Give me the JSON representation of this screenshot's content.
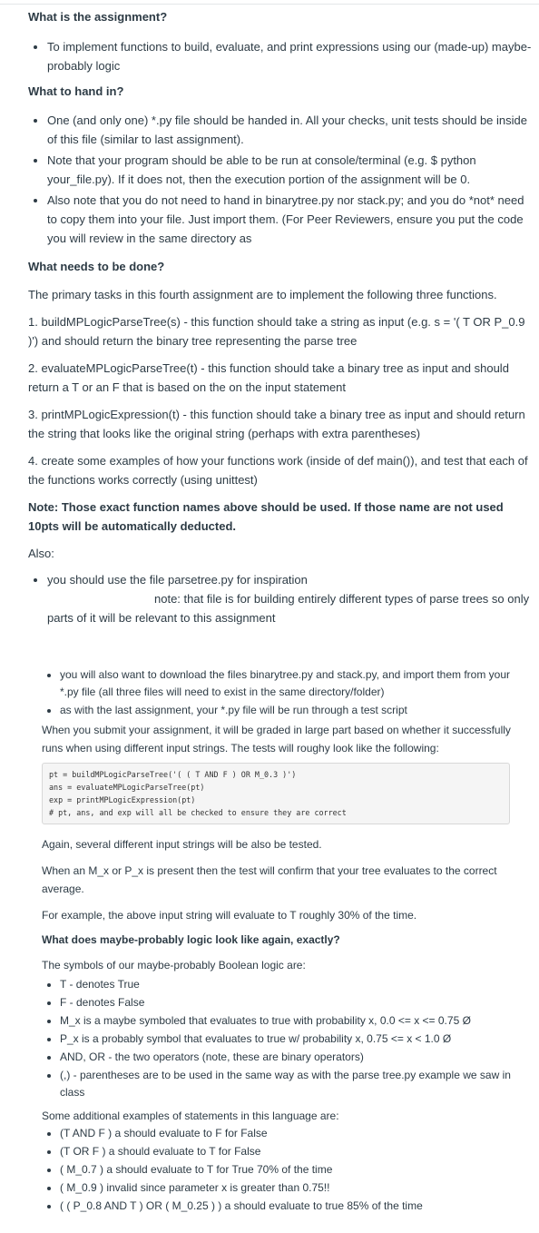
{
  "assignment": {
    "heading": "What is the assignment?",
    "bullets": [
      "To implement functions to build, evaluate, and print expressions using our (made-up) maybe-probably logic"
    ]
  },
  "handin": {
    "heading": "What to hand in?",
    "bullets": [
      "One (and only one) *.py file should be handed in. All your checks, unit tests should be inside of this file (similar to last assignment).",
      "Note that your program should be able to be run at console/terminal (e.g. $ python your_file.py). If it does not, then the execution portion of the assignment will be 0.",
      "Also note that you do not need to hand in binarytree.py nor stack.py; and you do *not* need to copy them into your file. Just import them. (For Peer Reviewers, ensure you put the code you will review in the same directory as"
    ]
  },
  "todo": {
    "heading": "What needs to be done?",
    "intro": "The primary tasks in this fourth assignment are to implement the following three functions.",
    "items": [
      "1. buildMPLogicParseTree(s) - this function should take a string as input (e.g. s = '( T OR P_0.9 )') and should return the binary tree representing the parse tree",
      "2. evaluateMPLogicParseTree(t) - this function should take a binary tree as input and should return a T or an F that is based on the on the input statement",
      "3. printMPLogicExpression(t) - this function should take a binary tree as input and should return the string that looks like the original string (perhaps with extra parentheses)",
      "4. create some examples of how your functions work (inside of def main()), and test that each of the functions works correctly (using unittest)"
    ],
    "note": "Note: Those exact function names above should be used. If those name are not used 10pts will be automatically deducted.",
    "also": "Also:",
    "also_bullet": "you should use the file parsetree.py for inspiration",
    "also_note": "note: that file is for building entirely different types of parse trees so only",
    "also_note_cont": "parts of it will be relevant to this assignment"
  },
  "sub": {
    "bullets": [
      "you will also want to download the files binarytree.py and stack.py, and import them from your *.py file (all three files will need to exist in the same directory/folder)",
      "as with the last assignment, your *.py file will be run through a test script"
    ],
    "submit_text": "When you submit your assignment, it will be graded in large part based on whether it successfully runs when using different input strings. The tests will roughy look like the following:",
    "code": "pt = buildMPLogicParseTree('( ( T AND F ) OR M_0.3 )')\nans = evaluateMPLogicParseTree(pt)\nexp = printMPLogicExpression(pt)\n# pt, ans, and exp will all be checked to ensure they are correct",
    "again": "Again, several different input strings will be also be tested.",
    "when": "When an M_x or P_x is present then the test will confirm that your tree evaluates to the correct average.",
    "example": "For example, the above input string will evaluate to T roughly 30% of the time.",
    "heading": "What does maybe-probably logic look like again, exactly?",
    "symbols_intro": "The symbols of our maybe-probably Boolean logic are:",
    "symbols": [
      "T - denotes True",
      "F - denotes False",
      "M_x is a maybe symboled that evaluates to true with probability x, 0.0 <= x <= 0.75 Ø",
      "P_x is a probably symbol that evaluates to true w/ probability x, 0.75 <= x < 1.0 Ø",
      "AND, OR - the two operators (note, these are binary operators)",
      "(,) - parentheses are to be used in the same way as with the parse tree.py example we saw in class"
    ],
    "examples_intro": "Some additional examples of statements in this language are:",
    "examples": [
      "(T AND F ) a should evaluate to F for False",
      "(T OR F ) a should evaluate to T for False",
      "( M_0.7 ) a should evaluate to T for True 70% of the time",
      "( M_0.9 ) invalid since parameter x is greater than 0.75!!",
      "( ( P_0.8 AND T ) OR ( M_0.25 ) ) a should evaluate to true 85% of the time"
    ]
  }
}
